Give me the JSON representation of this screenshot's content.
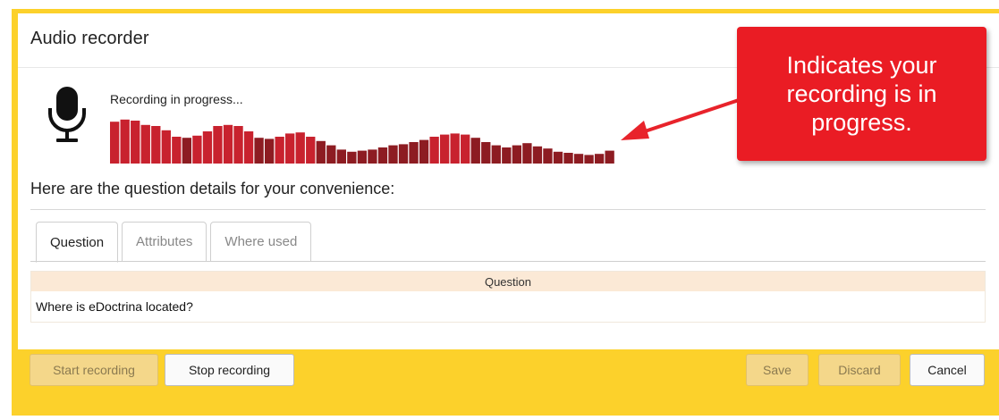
{
  "dialog": {
    "title": "Audio recorder",
    "recording_status": "Recording in progress...",
    "details_heading": "Here are the question details for your convenience:"
  },
  "mic_icon": "microphone-icon",
  "waveform": {
    "color_loud": "#c8222e",
    "color_quiet": "#8d1c22",
    "levels": [
      0.78,
      0.82,
      0.8,
      0.72,
      0.7,
      0.62,
      0.5,
      0.48,
      0.52,
      0.6,
      0.7,
      0.72,
      0.7,
      0.6,
      0.48,
      0.46,
      0.5,
      0.56,
      0.58,
      0.5,
      0.42,
      0.34,
      0.26,
      0.22,
      0.24,
      0.26,
      0.3,
      0.34,
      0.36,
      0.4,
      0.44,
      0.5,
      0.54,
      0.56,
      0.54,
      0.48,
      0.4,
      0.34,
      0.3,
      0.34,
      0.38,
      0.32,
      0.28,
      0.22,
      0.2,
      0.18,
      0.16,
      0.18,
      0.24
    ]
  },
  "callout": {
    "text": "Indicates your recording is in progress.",
    "color": "#ea1c24"
  },
  "tabs": [
    {
      "label": "Question",
      "active": true
    },
    {
      "label": "Attributes",
      "active": false
    },
    {
      "label": "Where used",
      "active": false
    }
  ],
  "question_table": {
    "header": "Question",
    "rows": [
      "Where is eDoctrina located?"
    ]
  },
  "footer": {
    "start_recording": "Start recording",
    "stop_recording": "Stop recording",
    "save": "Save",
    "discard": "Discard",
    "cancel": "Cancel"
  },
  "colors": {
    "frame": "#fcd12b",
    "header_row": "#fbe9d6"
  }
}
